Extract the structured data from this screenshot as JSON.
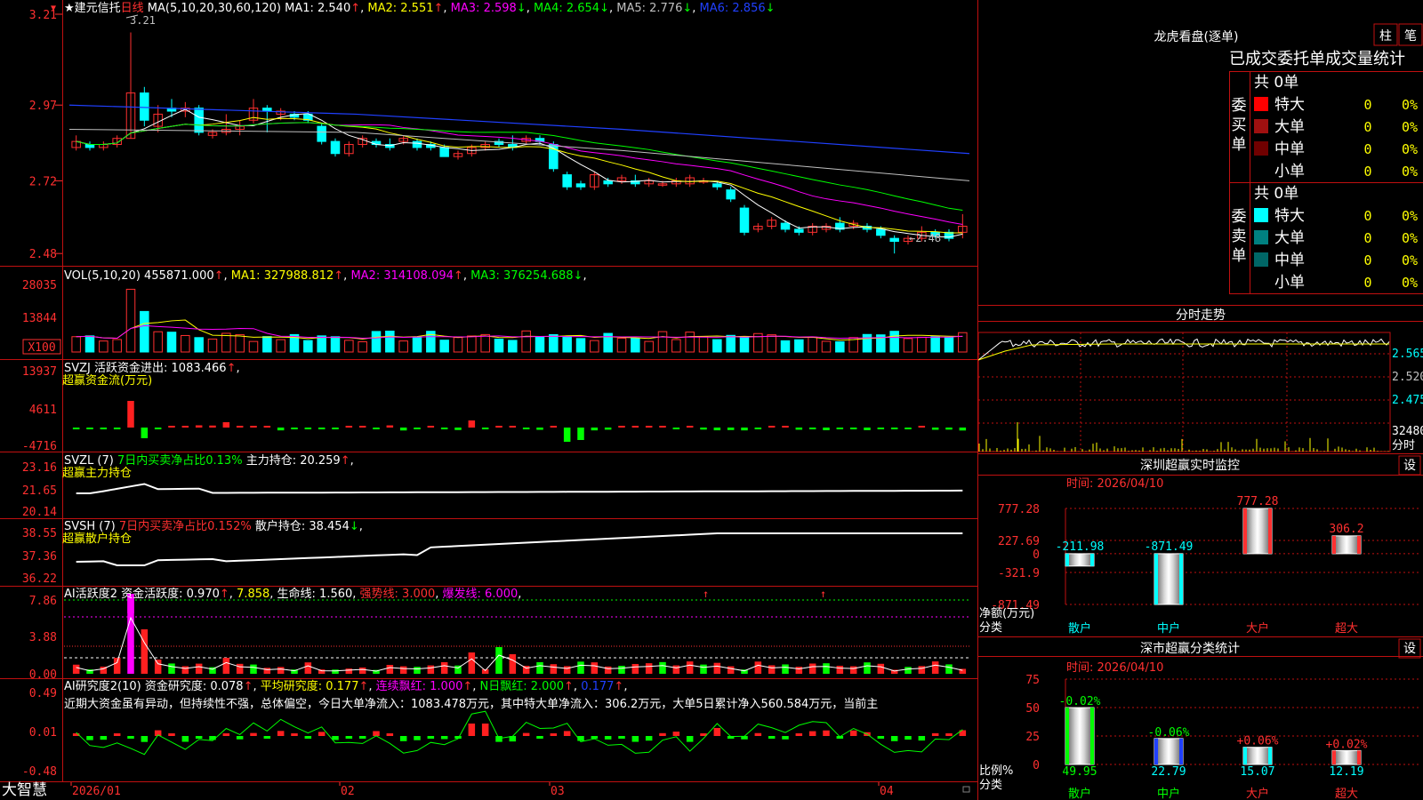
{
  "app": {
    "name": "大智慧"
  },
  "stock": {
    "name": "★建元信托",
    "period": "日线"
  },
  "price_panel": {
    "ma_header": "MA(5,10,20,30,60,120)",
    "ma_items": [
      {
        "label": "MA1:",
        "value": "2.540",
        "arrow": "↑",
        "color": "#ffffff"
      },
      {
        "label": "MA2:",
        "value": "2.551",
        "arrow": "↑",
        "color": "#ffff00"
      },
      {
        "label": "MA3:",
        "value": "2.598",
        "arrow": "↓",
        "color": "#ff00ff"
      },
      {
        "label": "MA4:",
        "value": "2.654",
        "arrow": "↓",
        "color": "#00ff00"
      },
      {
        "label": "MA5:",
        "value": "2.776",
        "arrow": "↓",
        "color": "#c0c0c0"
      },
      {
        "label": "MA6:",
        "value": "2.856",
        "arrow": "↓",
        "color": "#2040ff"
      }
    ],
    "y_ticks": [
      "3.21",
      "2.97",
      "2.72",
      "2.48"
    ],
    "high_label": "3.21",
    "low_label": "←2.48"
  },
  "vol_panel": {
    "header": "VOL(5,10,20)",
    "items": [
      {
        "label": "",
        "value": "455871.000",
        "arrow": "↑",
        "color": "#ffffff"
      },
      {
        "label": "MA1:",
        "value": "327988.812",
        "arrow": "↑",
        "color": "#ffff00"
      },
      {
        "label": "MA2:",
        "value": "314108.094",
        "arrow": "↑",
        "color": "#ff00ff"
      },
      {
        "label": "MA3:",
        "value": "376254.688",
        "arrow": "↓",
        "color": "#00ff00"
      }
    ],
    "y_ticks": [
      "28035",
      "13844"
    ],
    "unit": "X100"
  },
  "svzj_panel": {
    "header": "SVZJ",
    "label": "活跃资金进出:",
    "value": "1083.466",
    "arrow": "↑",
    "subtitle": "超赢资金流(万元)",
    "y_ticks": [
      "13937",
      "4611",
      "-4716"
    ]
  },
  "svzl_panel": {
    "header": "SVZL (7)",
    "ratio_text": "7日内买卖净占比0.13%",
    "label": "主力持仓:",
    "value": "20.259",
    "arrow": "↑",
    "subtitle": "超赢主力持仓",
    "y_ticks": [
      "23.16",
      "21.65",
      "20.14"
    ]
  },
  "svsh_panel": {
    "header": "SVSH (7)",
    "ratio_text": "7日内买卖净占比0.152%",
    "label": "散户持仓:",
    "value": "38.454",
    "arrow": "↓",
    "subtitle": "超赢散户持仓",
    "y_ticks": [
      "38.55",
      "37.36",
      "36.22"
    ]
  },
  "ai_active_panel": {
    "header": "AI活跃度2",
    "items": [
      {
        "label": "资金活跃度:",
        "value": "0.970",
        "arrow": "↑",
        "color": "#ffffff"
      },
      {
        "label": "",
        "value": "7.858",
        "arrow": "",
        "color": "#ffff00"
      },
      {
        "label": "生命线:",
        "value": "1.560",
        "arrow": "",
        "color": "#ffffff"
      },
      {
        "label": "强势线:",
        "value": "3.000",
        "arrow": "",
        "color": "#ff3030"
      },
      {
        "label": "爆发线:",
        "value": "6.000",
        "arrow": "",
        "color": "#ff00ff"
      }
    ],
    "y_ticks": [
      "7.86",
      "3.88",
      "0.00"
    ]
  },
  "ai_research_panel": {
    "header": "AI研究度2(10)",
    "items": [
      {
        "label": "资金研究度:",
        "value": "0.078",
        "arrow": "↑",
        "color": "#ffffff"
      },
      {
        "label": "平均研究度:",
        "value": "0.177",
        "arrow": "↑",
        "color": "#ffff00"
      },
      {
        "label": "连续飘红:",
        "value": "1.000",
        "arrow": "↑",
        "color": "#ff00ff"
      },
      {
        "label": "N日飘红:",
        "value": "2.000",
        "arrow": "↑",
        "color": "#00ff00"
      },
      {
        "label": "",
        "value": "0.177",
        "arrow": "↑",
        "color": "#2040ff"
      }
    ],
    "comment": "近期大资金虽有异动，但持续性不强，总体偏空，今日大单净流入：1083.478万元，其中特大单净流入：306.2万元，大单5日累计净入560.584万元，当前主",
    "y_ticks": [
      "0.49",
      "0.01",
      "-0.48"
    ]
  },
  "date_axis": [
    "2026/01",
    "02",
    "03",
    "04"
  ],
  "dragon_tiger": {
    "title": "龙虎看盘(逐单)",
    "btn_bar": "柱",
    "btn_pen": "笔",
    "subtitle": "已成交委托单成交量统计",
    "buy": {
      "side_label": "委买单",
      "total": "共 0单",
      "rows": [
        {
          "name": "特大",
          "count": "0",
          "pct": "0%",
          "color": "#ff0000"
        },
        {
          "name": "大单",
          "count": "0",
          "pct": "0%",
          "color": "#a01010"
        },
        {
          "name": "中单",
          "count": "0",
          "pct": "0%",
          "color": "#700000"
        },
        {
          "name": "小单",
          "count": "0",
          "pct": "0%",
          "color": ""
        }
      ]
    },
    "sell": {
      "side_label": "委卖单",
      "total": "共 0单",
      "rows": [
        {
          "name": "特大",
          "count": "0",
          "pct": "0%",
          "color": "#00ffff"
        },
        {
          "name": "大单",
          "count": "0",
          "pct": "0%",
          "color": "#008080"
        },
        {
          "name": "中单",
          "count": "0",
          "pct": "0%",
          "color": "#006666"
        },
        {
          "name": "小单",
          "count": "0",
          "pct": "0%",
          "color": ""
        }
      ]
    }
  },
  "intraday": {
    "title": "分时走势",
    "price_ticks": [
      "2.565",
      "2.520",
      "2.475"
    ],
    "vol_tick": "32480",
    "vol_label": "分时"
  },
  "sz_monitor": {
    "title": "深圳超赢实时监控",
    "btn": "设",
    "time": "时间: 2026/04/10",
    "y_ticks": [
      "777.28",
      "227.69",
      "0",
      "-321.9",
      "-871.49"
    ],
    "y_label": "净额(万元)",
    "x_label": "分类",
    "categories": [
      "散户",
      "中户",
      "大户",
      "超大"
    ],
    "values": [
      -211.98,
      -871.49,
      777.28,
      306.2
    ],
    "value_labels": [
      "-211.98",
      "-871.49",
      "777.28",
      "306.2"
    ],
    "ylim": [
      -871.49,
      777.28
    ]
  },
  "sz_classify": {
    "title": "深市超赢分类统计",
    "btn": "设",
    "time": "时间: 2026/04/10",
    "y_ticks": [
      "75",
      "50",
      "25",
      "0"
    ],
    "y_label": "比例%",
    "x_label": "分类",
    "categories": [
      "散户",
      "中户",
      "大户",
      "超大"
    ],
    "values": [
      49.95,
      22.79,
      15.07,
      12.19
    ],
    "value_labels": [
      "49.95",
      "22.79",
      "15.07",
      "12.19"
    ],
    "changes": [
      "-0.02%",
      "-0.06%",
      "+0.06%",
      "+0.02%"
    ],
    "ylim": [
      0,
      75
    ]
  },
  "chart_data": {
    "type": "candlestick",
    "dates_axis": [
      "2026/01",
      "02",
      "03",
      "04"
    ],
    "candles": [
      [
        2.83,
        2.85,
        2.82,
        2.87
      ],
      [
        2.84,
        2.83,
        2.82,
        2.85
      ],
      [
        2.83,
        2.84,
        2.82,
        2.85
      ],
      [
        2.84,
        2.86,
        2.83,
        2.87
      ],
      [
        2.86,
        3.01,
        2.86,
        3.21
      ],
      [
        3.01,
        2.92,
        2.9,
        3.03
      ],
      [
        2.9,
        2.94,
        2.88,
        2.97
      ],
      [
        2.96,
        2.95,
        2.93,
        2.99
      ],
      [
        2.95,
        2.96,
        2.93,
        2.98
      ],
      [
        2.96,
        2.88,
        2.87,
        2.97
      ],
      [
        2.87,
        2.88,
        2.86,
        2.89
      ],
      [
        2.88,
        2.89,
        2.87,
        2.94
      ],
      [
        2.89,
        2.9,
        2.87,
        2.92
      ],
      [
        2.92,
        2.96,
        2.91,
        2.99
      ],
      [
        2.96,
        2.95,
        2.88,
        2.97
      ],
      [
        2.94,
        2.95,
        2.92,
        2.96
      ],
      [
        2.94,
        2.93,
        2.92,
        2.95
      ],
      [
        2.94,
        2.92,
        2.91,
        2.95
      ],
      [
        2.9,
        2.85,
        2.84,
        2.91
      ],
      [
        2.85,
        2.81,
        2.8,
        2.86
      ],
      [
        2.81,
        2.84,
        2.8,
        2.85
      ],
      [
        2.84,
        2.86,
        2.83,
        2.87
      ],
      [
        2.85,
        2.84,
        2.83,
        2.86
      ],
      [
        2.84,
        2.83,
        2.82,
        2.86
      ],
      [
        2.85,
        2.86,
        2.84,
        2.87
      ],
      [
        2.85,
        2.83,
        2.82,
        2.86
      ],
      [
        2.84,
        2.83,
        2.82,
        2.85
      ],
      [
        2.83,
        2.8,
        2.8,
        2.84
      ],
      [
        2.8,
        2.81,
        2.79,
        2.82
      ],
      [
        2.81,
        2.83,
        2.8,
        2.84
      ],
      [
        2.83,
        2.84,
        2.82,
        2.85
      ],
      [
        2.85,
        2.84,
        2.83,
        2.86
      ],
      [
        2.84,
        2.83,
        2.82,
        2.87
      ],
      [
        2.85,
        2.86,
        2.84,
        2.87
      ],
      [
        2.86,
        2.85,
        2.84,
        2.87
      ],
      [
        2.84,
        2.76,
        2.75,
        2.85
      ],
      [
        2.74,
        2.7,
        2.69,
        2.75
      ],
      [
        2.71,
        2.7,
        2.69,
        2.72
      ],
      [
        2.7,
        2.74,
        2.69,
        2.75
      ],
      [
        2.72,
        2.71,
        2.7,
        2.73
      ],
      [
        2.72,
        2.73,
        2.71,
        2.74
      ],
      [
        2.72,
        2.71,
        2.7,
        2.74
      ],
      [
        2.71,
        2.72,
        2.7,
        2.73
      ],
      [
        2.71,
        2.71,
        2.7,
        2.72
      ],
      [
        2.71,
        2.72,
        2.7,
        2.73
      ],
      [
        2.71,
        2.73,
        2.7,
        2.74
      ],
      [
        2.72,
        2.72,
        2.71,
        2.73
      ],
      [
        2.71,
        2.7,
        2.69,
        2.72
      ],
      [
        2.69,
        2.66,
        2.65,
        2.7
      ],
      [
        2.63,
        2.55,
        2.54,
        2.64
      ],
      [
        2.56,
        2.57,
        2.55,
        2.58
      ],
      [
        2.57,
        2.59,
        2.56,
        2.6
      ],
      [
        2.58,
        2.56,
        2.55,
        2.59
      ],
      [
        2.56,
        2.55,
        2.54,
        2.57
      ],
      [
        2.55,
        2.57,
        2.54,
        2.58
      ],
      [
        2.56,
        2.57,
        2.55,
        2.58
      ],
      [
        2.58,
        2.56,
        2.55,
        2.6
      ],
      [
        2.57,
        2.58,
        2.56,
        2.59
      ],
      [
        2.57,
        2.56,
        2.55,
        2.58
      ],
      [
        2.56,
        2.54,
        2.53,
        2.57
      ],
      [
        2.53,
        2.52,
        2.48,
        2.54
      ],
      [
        2.52,
        2.53,
        2.51,
        2.54
      ],
      [
        2.53,
        2.55,
        2.52,
        2.57
      ],
      [
        2.55,
        2.54,
        2.53,
        2.56
      ],
      [
        2.55,
        2.53,
        2.52,
        2.56
      ],
      [
        2.55,
        2.57,
        2.53,
        2.61
      ]
    ],
    "price_ylim": [
      2.46,
      3.27
    ]
  }
}
